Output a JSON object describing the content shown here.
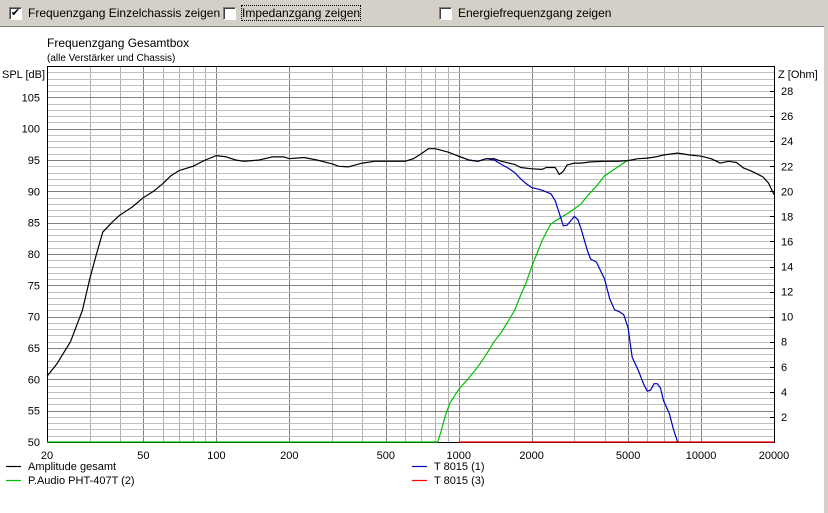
{
  "toolbar": {
    "checkboxes": [
      {
        "label": "Frequenzgang Einzelchassis zeigen",
        "checked": true
      },
      {
        "label": "Impedanzgang zeigen",
        "checked": false
      },
      {
        "label": "Energiefrequenzgang zeigen",
        "checked": false
      }
    ]
  },
  "chart_data": {
    "type": "line",
    "title": "Frequenzgang Gesamtbox",
    "subtitle": "(alle Verstärker und Chassis)",
    "ylabel": "SPL [dB]",
    "y2label": "Z [Ohm]",
    "xscale": "log",
    "xlim": [
      20,
      20000
    ],
    "ylim": [
      50,
      110
    ],
    "y2lim": [
      0,
      30
    ],
    "x_ticks": [
      20,
      50,
      100,
      200,
      500,
      1000,
      2000,
      5000,
      10000,
      20000
    ],
    "x_tick_labels": [
      "20",
      "50",
      "100",
      "200",
      "500",
      "1000",
      "2000",
      "5000",
      "10000",
      "20000"
    ],
    "y_ticks": [
      50,
      55,
      60,
      65,
      70,
      75,
      80,
      85,
      90,
      95,
      100,
      105
    ],
    "y_tick_labels": [
      "50",
      "55",
      "60",
      "65",
      "70",
      "75",
      "80",
      "85",
      "90",
      "95",
      "100",
      "105"
    ],
    "y2_ticks": [
      2,
      4,
      6,
      8,
      10,
      12,
      14,
      16,
      18,
      20,
      22,
      24,
      26,
      28
    ],
    "y2_tick_labels": [
      "2",
      "4",
      "6",
      "8",
      "10",
      "12",
      "14",
      "16",
      "18",
      "20",
      "22",
      "24",
      "26",
      "28"
    ],
    "grid": true,
    "colors": {
      "amplitude": "#000000",
      "pht": "#00c000",
      "t8015_1": "#0000c0",
      "t8015_3": "#ff0000",
      "grid": "#808080"
    },
    "series": [
      {
        "name": "Amplitude gesamt",
        "color": "#000000",
        "points": [
          [
            20,
            60.5
          ],
          [
            22,
            62.5
          ],
          [
            25,
            66
          ],
          [
            28,
            71
          ],
          [
            30,
            76
          ],
          [
            32,
            80
          ],
          [
            34,
            83.5
          ],
          [
            37,
            85
          ],
          [
            40,
            86.2
          ],
          [
            45,
            87.5
          ],
          [
            50,
            89
          ],
          [
            55,
            90
          ],
          [
            60,
            91.2
          ],
          [
            65,
            92.5
          ],
          [
            70,
            93.3
          ],
          [
            80,
            94
          ],
          [
            90,
            95
          ],
          [
            100,
            95.7
          ],
          [
            110,
            95.5
          ],
          [
            120,
            95
          ],
          [
            130,
            94.8
          ],
          [
            140,
            94.9
          ],
          [
            150,
            95
          ],
          [
            170,
            95.5
          ],
          [
            190,
            95.5
          ],
          [
            200,
            95.2
          ],
          [
            230,
            95.4
          ],
          [
            260,
            95
          ],
          [
            300,
            94.4
          ],
          [
            320,
            94
          ],
          [
            350,
            93.9
          ],
          [
            400,
            94.5
          ],
          [
            450,
            94.8
          ],
          [
            500,
            94.8
          ],
          [
            600,
            94.8
          ],
          [
            650,
            95.2
          ],
          [
            700,
            96
          ],
          [
            750,
            96.8
          ],
          [
            800,
            96.8
          ],
          [
            900,
            96.3
          ],
          [
            1000,
            95.6
          ],
          [
            1100,
            95
          ],
          [
            1200,
            94.8
          ],
          [
            1300,
            95.2
          ],
          [
            1400,
            95.2
          ],
          [
            1500,
            94.8
          ],
          [
            1700,
            94.3
          ],
          [
            1800,
            93.8
          ],
          [
            2000,
            93.6
          ],
          [
            2200,
            93.5
          ],
          [
            2300,
            93.8
          ],
          [
            2500,
            93.8
          ],
          [
            2600,
            92.7
          ],
          [
            2700,
            93.2
          ],
          [
            2800,
            94.2
          ],
          [
            3000,
            94.5
          ],
          [
            3200,
            94.5
          ],
          [
            3500,
            94.7
          ],
          [
            4000,
            94.8
          ],
          [
            4500,
            94.8
          ],
          [
            5000,
            94.9
          ],
          [
            5500,
            95.2
          ],
          [
            6000,
            95.3
          ],
          [
            6500,
            95.5
          ],
          [
            7000,
            95.8
          ],
          [
            8000,
            96.1
          ],
          [
            9000,
            95.8
          ],
          [
            10000,
            95.6
          ],
          [
            11000,
            95.2
          ],
          [
            12000,
            94.5
          ],
          [
            13000,
            94.8
          ],
          [
            14000,
            94.6
          ],
          [
            15000,
            93.7
          ],
          [
            16000,
            93.3
          ],
          [
            17000,
            92.8
          ],
          [
            18000,
            92.3
          ],
          [
            19000,
            91.3
          ],
          [
            20000,
            89.5
          ]
        ]
      },
      {
        "name": "T 8015 (1)",
        "color": "#0000c0",
        "points": [
          [
            1000,
            95.6
          ],
          [
            1100,
            95
          ],
          [
            1200,
            94.8
          ],
          [
            1300,
            95.2
          ],
          [
            1400,
            95
          ],
          [
            1500,
            94.3
          ],
          [
            1600,
            93.7
          ],
          [
            1700,
            93
          ],
          [
            1800,
            92
          ],
          [
            1900,
            91.2
          ],
          [
            2000,
            90.6
          ],
          [
            2200,
            90.2
          ],
          [
            2400,
            89.6
          ],
          [
            2500,
            88.5
          ],
          [
            2600,
            86.5
          ],
          [
            2700,
            84.5
          ],
          [
            2800,
            84.6
          ],
          [
            2900,
            85.3
          ],
          [
            3000,
            86
          ],
          [
            3100,
            85.5
          ],
          [
            3200,
            84
          ],
          [
            3400,
            80.5
          ],
          [
            3500,
            79.2
          ],
          [
            3700,
            78.7
          ],
          [
            3800,
            77.8
          ],
          [
            4000,
            76
          ],
          [
            4200,
            72.8
          ],
          [
            4400,
            71.1
          ],
          [
            4600,
            70.8
          ],
          [
            4800,
            70.3
          ],
          [
            5000,
            68.2
          ],
          [
            5200,
            63.5
          ],
          [
            5500,
            61.5
          ],
          [
            5800,
            59.2
          ],
          [
            6000,
            58.1
          ],
          [
            6200,
            58.3
          ],
          [
            6400,
            59.3
          ],
          [
            6600,
            59.3
          ],
          [
            6800,
            58.6
          ],
          [
            7000,
            56.6
          ],
          [
            7400,
            54.5
          ],
          [
            7700,
            52
          ],
          [
            8000,
            50
          ]
        ]
      },
      {
        "name": "P.Audio PHT-407T (2)",
        "color": "#00c000",
        "points": [
          [
            20,
            50
          ],
          [
            820,
            50
          ],
          [
            850,
            52
          ],
          [
            880,
            54.2
          ],
          [
            920,
            56.2
          ],
          [
            1000,
            58.4
          ],
          [
            1100,
            60.2
          ],
          [
            1200,
            62
          ],
          [
            1300,
            64
          ],
          [
            1400,
            66
          ],
          [
            1500,
            67.5
          ],
          [
            1600,
            69.3
          ],
          [
            1700,
            71
          ],
          [
            1800,
            73.4
          ],
          [
            1900,
            75.5
          ],
          [
            2000,
            78
          ],
          [
            2100,
            80
          ],
          [
            2200,
            82
          ],
          [
            2300,
            83.5
          ],
          [
            2400,
            84.8
          ],
          [
            2600,
            85.7
          ],
          [
            2800,
            86.4
          ],
          [
            3000,
            87.2
          ],
          [
            3200,
            88
          ],
          [
            3400,
            89.3
          ],
          [
            3700,
            90.8
          ],
          [
            4000,
            92.5
          ],
          [
            4500,
            93.8
          ],
          [
            5000,
            95
          ]
        ]
      },
      {
        "name": "T 8015 (3)",
        "color": "#ff0000",
        "points": [
          [
            1000,
            50
          ],
          [
            20000,
            50
          ]
        ]
      }
    ],
    "legend": [
      {
        "label": "Amplitude gesamt",
        "color": "#000000"
      },
      {
        "label": "T 8015 (1)",
        "color": "#0000c0"
      },
      {
        "label": "P.Audio PHT-407T (2)",
        "color": "#00c000"
      },
      {
        "label": "T 8015 (3)",
        "color": "#ff0000"
      }
    ],
    "legend_position": "bottom"
  }
}
